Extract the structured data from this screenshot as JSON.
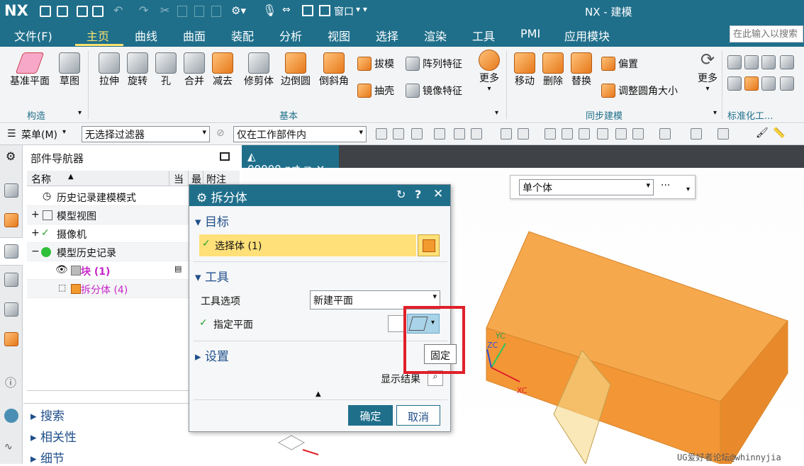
{
  "app": {
    "logo": "NX",
    "title": "NX - 建模",
    "window_menu": "窗口"
  },
  "menu": {
    "tabs": [
      "文件(F)",
      "主页",
      "曲线",
      "曲面",
      "装配",
      "分析",
      "视图",
      "选择",
      "渲染",
      "工具",
      "PMI",
      "应用模块"
    ],
    "active": "主页",
    "search_placeholder": "在此输入以搜索"
  },
  "ribbon": {
    "construct": {
      "items": [
        "基准平面",
        "草图"
      ],
      "group": "构造"
    },
    "basic": {
      "items": [
        "拉伸",
        "旋转",
        "孔",
        "合并",
        "减去",
        "修剪体",
        "边倒圆",
        "倒斜角"
      ],
      "small": [
        "拔模",
        "阵列特征",
        "抽壳",
        "镜像特征"
      ],
      "more": "更多",
      "group": "基本"
    },
    "sync": {
      "items": [
        "移动",
        "删除",
        "替换"
      ],
      "small": [
        "偏置",
        "调整圆角大小"
      ],
      "more": "更多",
      "group": "同步建模"
    },
    "std": {
      "group": "标准化工..."
    }
  },
  "filterbar": {
    "menu": "菜单(M)",
    "filter": "无选择过滤器",
    "scope": "仅在工作部件内"
  },
  "navigator": {
    "title": "部件导航器",
    "columns": [
      "名称",
      "当",
      "最",
      "附注"
    ],
    "rows": [
      {
        "label": "历史记录建模模式"
      },
      {
        "label": "模型视图",
        "expander": "+"
      },
      {
        "label": "摄像机",
        "expander": "+"
      },
      {
        "label": "模型历史记录",
        "expander": "−"
      },
      {
        "label": "块 (1)",
        "color": "#c627c9"
      },
      {
        "label": "拆分体 (4)",
        "color": "#c627c9"
      }
    ],
    "sections": [
      "搜索",
      "相关性",
      "细节"
    ]
  },
  "viewport": {
    "tab": "00000.prt",
    "body_select": "单个体",
    "more": "···",
    "axis_labels": [
      "YC",
      "ZC",
      "XC"
    ],
    "watermark": "UG爱好者论坛@whinnyjia"
  },
  "dialog": {
    "title": "拆分体",
    "target_section": "目标",
    "select_body": "选择体 (1)",
    "tool_section": "工具",
    "tool_option_label": "工具选项",
    "tool_option_value": "新建平面",
    "plane_label": "指定平面",
    "settings_section": "设置",
    "show_result": "显示结果",
    "ok": "确定",
    "cancel": "取消",
    "tooltip": "固定"
  },
  "colors": {
    "accent": "#1f6f8b",
    "highlight": "#ffe079",
    "body_orange": "#f6a84d",
    "callout": "#e0202a"
  }
}
